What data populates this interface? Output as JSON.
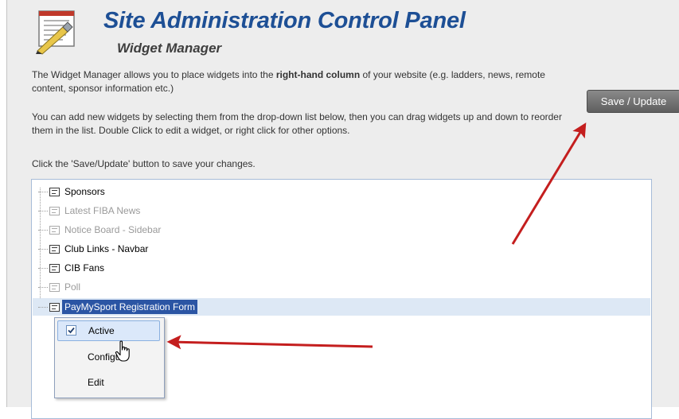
{
  "header": {
    "title": "Site Administration Control Panel",
    "subtitle": "Widget Manager"
  },
  "intro": {
    "p1_before": "The Widget Manager allows you to place widgets into the ",
    "p1_bold": "right-hand column",
    "p1_after": " of your website (e.g. ladders, news, remote content, sponsor information etc.)",
    "p2": "You can add new widgets by selecting them from the drop-down list below, then you can drag widgets up and down to reorder them in the list. Double Click to edit a widget, or right click for other options.",
    "p3": "Click the 'Save/Update' button to save your changes."
  },
  "toolbar": {
    "save_label": "Save / Update"
  },
  "widgets": [
    {
      "label": "Sponsors",
      "active": true
    },
    {
      "label": "Latest FIBA News",
      "active": false
    },
    {
      "label": "Notice Board - Sidebar",
      "active": false
    },
    {
      "label": "Club Links - Navbar",
      "active": true
    },
    {
      "label": "CIB Fans",
      "active": true
    },
    {
      "label": "Poll",
      "active": false
    },
    {
      "label": "PayMySport Registration Form",
      "active": true,
      "selected": true
    }
  ],
  "context_menu": {
    "active_label": "Active",
    "active_checked": true,
    "configure_label": "Configure",
    "edit_label": "Edit"
  },
  "icons": {
    "logo": "admin-checklist-logo-icon",
    "widget": "widget-list-icon",
    "cursor": "hand-pointer-icon"
  },
  "colors": {
    "title": "#1d4f95",
    "selection": "#2b55a4",
    "annotation_arrow": "#c41e1e"
  }
}
